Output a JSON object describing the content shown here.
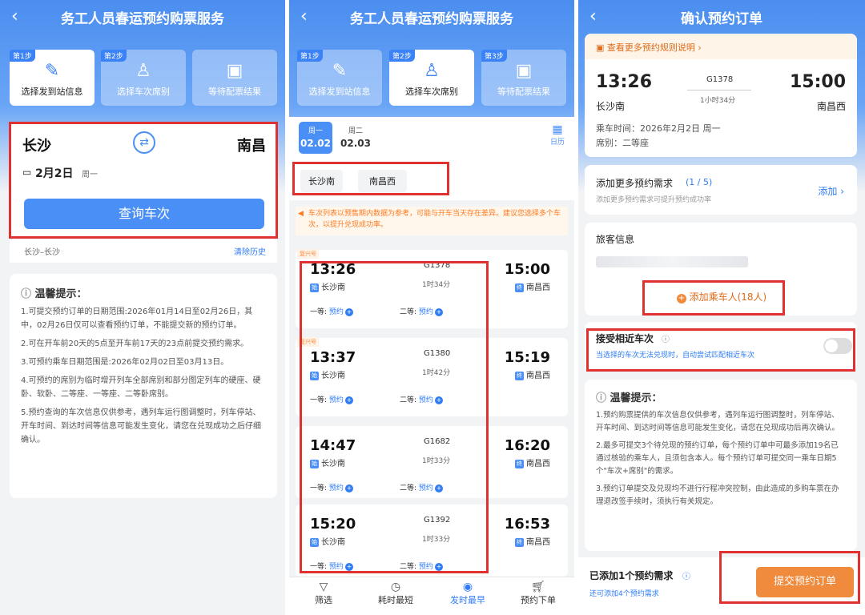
{
  "p1": {
    "title": "务工人员春运预约购票服务",
    "steps": [
      {
        "tag": "第1步",
        "label": "选择发到站信息"
      },
      {
        "tag": "第2步",
        "label": "选择车次席别"
      },
      {
        "tag": "",
        "label": "等待配票结果"
      }
    ],
    "from": "长沙",
    "to": "南昌",
    "date": "2月2日",
    "weekday": "周一",
    "query_button": "查询车次",
    "history": "长沙–长沙",
    "clear_history": "清除历史",
    "tips_title": "温馨提示：",
    "tips": [
      "1.可提交预约订单的日期范围:2026年01月14日至02月26日，其中，02月26日仅可以查看预约订单，不能提交新的预约订单。",
      "2.可在开车前20天的5点至开车前17天的23点前提交预约需求。",
      "3.可预约乘车日期范围是:2026年02月02日至03月13日。",
      "4.可预约的席别为临时增开列车全部席别和部分图定列车的硬座、硬卧、软卧、二等座、一等座、二等卧席别。",
      "5.预约查询的车次信息仅供参考，遇列车运行图调整时，列车停站、开车时间、到达时间等信息可能发生变化，请您在兑现成功之后仔细确认。"
    ]
  },
  "p2": {
    "title": "务工人员春运预约购票服务",
    "steps": [
      {
        "tag": "第1步",
        "label": "选择发到站信息"
      },
      {
        "tag": "第2步",
        "label": "选择车次席别"
      },
      {
        "tag": "第3步",
        "label": "等待配票结果"
      }
    ],
    "dates": [
      {
        "week": "周一",
        "date": "02.02"
      },
      {
        "week": "周二",
        "date": "02.03"
      }
    ],
    "calendar": "日历",
    "stations": [
      "长沙南",
      "南昌西"
    ],
    "notice": "车次列表以预售期内数据为参考，可能与开车当天存在差异。建议您选择多个车次，以提升兑现成功率。",
    "trains": [
      {
        "flag": "复兴号",
        "dep": "13:26",
        "no": "G1378",
        "dur": "1时34分",
        "arr": "15:00",
        "from": "长沙南",
        "to": "南昌西",
        "c1": "一等:",
        "c2": "二等:",
        "book": "预约"
      },
      {
        "flag": "复兴号",
        "dep": "13:37",
        "no": "G1380",
        "dur": "1时42分",
        "arr": "15:19",
        "from": "长沙南",
        "to": "南昌西",
        "c1": "一等:",
        "c2": "二等:",
        "book": "预约"
      },
      {
        "flag": "",
        "dep": "14:47",
        "no": "G1682",
        "dur": "1时33分",
        "arr": "16:20",
        "from": "长沙南",
        "to": "南昌西",
        "c1": "一等:",
        "c2": "二等:",
        "book": "预约"
      },
      {
        "flag": "",
        "dep": "15:20",
        "no": "G1392",
        "dur": "1时33分",
        "arr": "16:53",
        "from": "长沙南",
        "to": "南昌西",
        "c1": "一等:",
        "c2": "二等:",
        "book": "预约"
      }
    ],
    "sort": [
      "筛选",
      "耗时最短",
      "发时最早",
      "预约下单"
    ]
  },
  "p3": {
    "title": "确认预约订单",
    "rules_link": "查看更多预约规则说明",
    "dep": "13:26",
    "no": "G1378",
    "dur": "1小时34分",
    "arr": "15:00",
    "from": "长沙南",
    "to": "南昌西",
    "ride_time": "乘车时间：2026年2月2日 周一",
    "seat": "席别：二等座",
    "add_demand_title": "添加更多预约需求",
    "add_demand_count": "(1 / 5)",
    "add_demand_sub": "添加更多预约需求可提升预约成功率",
    "add_link": "添加",
    "passenger_title": "旅客信息",
    "add_passenger": "添加乘车人(18人)",
    "accept_title": "接受相近车次",
    "accept_sub": "当选择的车次无法兑现时，自动尝试匹配相近车次",
    "tips_title": "温馨提示：",
    "tips": [
      "1.预约购票提供的车次信息仅供参考，遇列车运行图调整时，列车停站、开车时间、到达时间等信息可能发生变化，请您在兑现成功后再次确认。",
      "2.最多可提交3个待兑现的预约订单，每个预约订单中可最多添加19名已通过核验的乘车人，且须包含本人。每个预约订单可提交同一乘车日期5个\"车次+席别\"的需求。",
      "3.预约订单提交及兑现均不进行行程冲突控制，由此造成的多购车票在办理退改签手续时，须执行有关规定。"
    ],
    "added": "已添加1个预约需求",
    "added_sub": "还可添加4个预约需求",
    "submit": "提交预约订单"
  },
  "colors": {
    "accent": "#4a8ff5",
    "highlight": "#e03131",
    "submit": "#f08a3c"
  }
}
